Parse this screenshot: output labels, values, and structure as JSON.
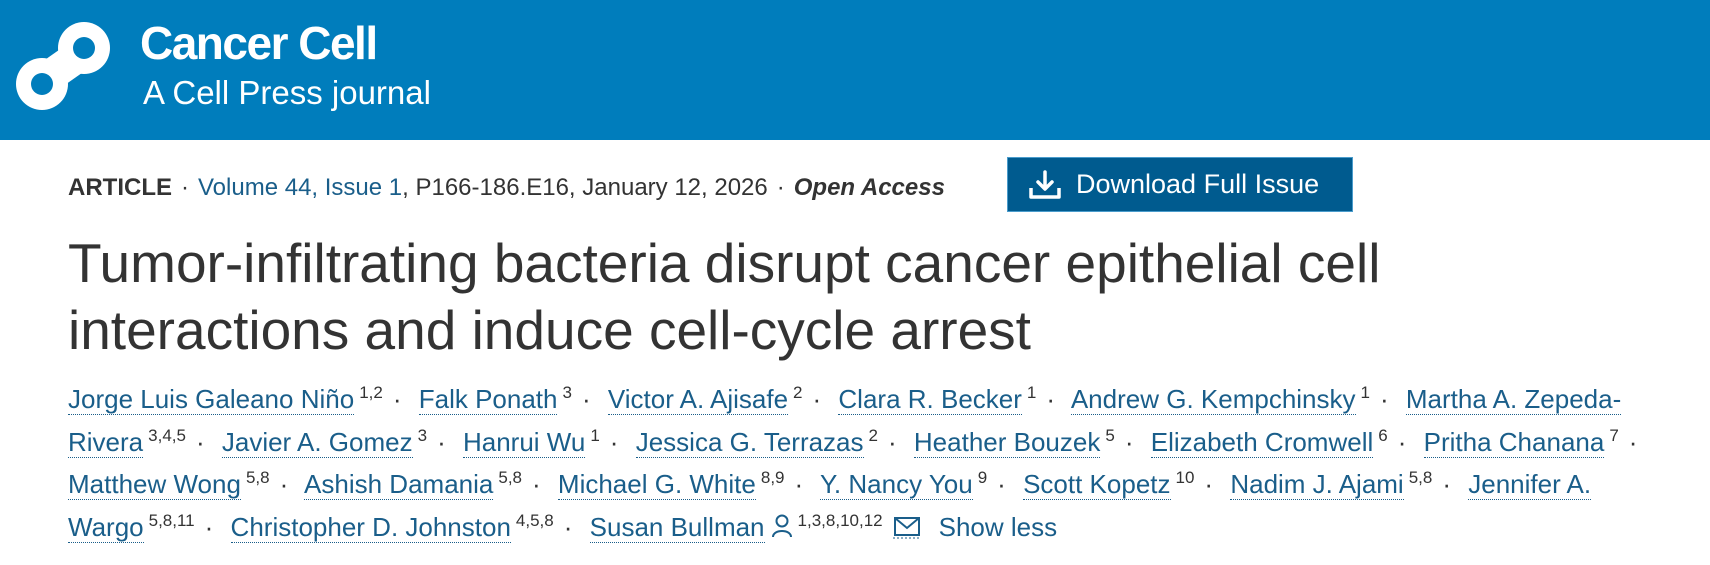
{
  "header": {
    "journal_name": "Cancer Cell",
    "journal_subtitle": "A Cell Press journal",
    "logo_icon": "cell-press-logo"
  },
  "meta": {
    "article_type": "ARTICLE",
    "volume_issue": "Volume 44, Issue 1",
    "pages_date": ", P166-186.E16, January 12, 2026",
    "access": "Open Access",
    "separator": "·"
  },
  "download": {
    "label": "Download Full Issue",
    "icon": "download-icon"
  },
  "article": {
    "title": "Tumor-infiltrating bacteria disrupt cancer epithelial cell interactions and induce cell-cycle arrest"
  },
  "authors": [
    {
      "name": "Jorge Luis Galeano Niño",
      "aff": "1,2"
    },
    {
      "name": "Falk Ponath",
      "aff": "3"
    },
    {
      "name": "Victor A. Ajisafe",
      "aff": "2"
    },
    {
      "name": "Clara R. Becker",
      "aff": "1"
    },
    {
      "name": "Andrew G. Kempchinsky",
      "aff": "1"
    },
    {
      "name": "Martha A. Zepeda-Rivera",
      "aff": "3,4,5"
    },
    {
      "name": "Javier A. Gomez",
      "aff": "3"
    },
    {
      "name": "Hanrui Wu",
      "aff": "1"
    },
    {
      "name": "Jessica G. Terrazas",
      "aff": "2"
    },
    {
      "name": "Heather Bouzek",
      "aff": "5"
    },
    {
      "name": "Elizabeth Cromwell",
      "aff": "6"
    },
    {
      "name": "Pritha Chanana",
      "aff": "7"
    },
    {
      "name": "Matthew Wong",
      "aff": "5,8"
    },
    {
      "name": "Ashish Damania",
      "aff": "5,8"
    },
    {
      "name": "Michael G. White",
      "aff": "8,9"
    },
    {
      "name": "Y. Nancy You",
      "aff": "9"
    },
    {
      "name": "Scott Kopetz",
      "aff": "10"
    },
    {
      "name": "Nadim J. Ajami",
      "aff": "5,8"
    },
    {
      "name": "Jennifer A. Wargo",
      "aff": "5,8,11"
    },
    {
      "name": "Christopher D. Johnston",
      "aff": "4,5,8"
    },
    {
      "name": "Susan Bullman",
      "aff": "1,3,8,10,12",
      "icon": "person-icon"
    }
  ],
  "authors_ui": {
    "show_less": "Show less",
    "email_icon": "mail-icon"
  }
}
